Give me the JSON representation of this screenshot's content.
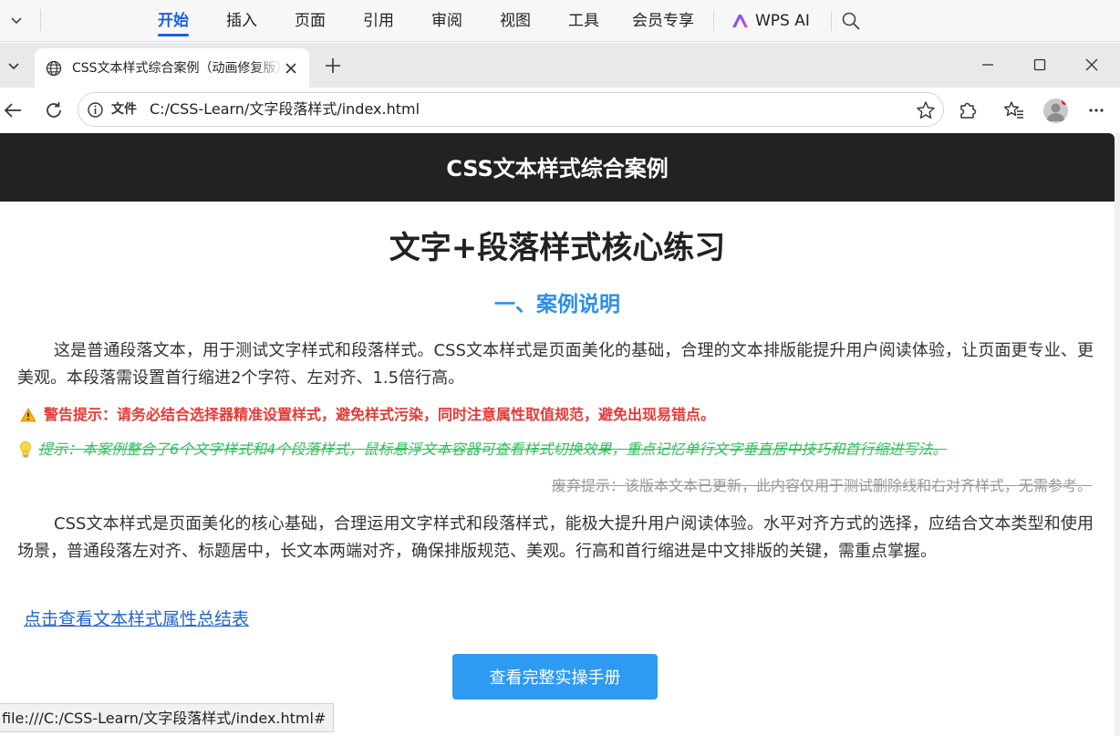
{
  "wps_ribbon": {
    "menu": [
      "开始",
      "插入",
      "页面",
      "引用",
      "审阅",
      "视图",
      "工具",
      "会员专享"
    ],
    "active_item": "开始",
    "ai_label": "WPS AI"
  },
  "browser": {
    "tab_title": "CSS文本样式综合案例（动画修复版）",
    "omnibox": {
      "scheme_label": "文件",
      "url": "C:/CSS-Learn/文字段落样式/index.html"
    },
    "status_url": "file:///C:/CSS-Learn/文字段落样式/index.html#"
  },
  "page": {
    "header_title": "CSS文本样式综合案例",
    "h1": "文字+段落样式核心练习",
    "h2": "一、案例说明",
    "paragraph1": "这是普通段落文本，用于测试文字样式和段落样式。CSS文本样式是页面美化的基础，合理的文本排版能提升用户阅读体验，让页面更专业、更美观。本段落需设置首行缩进2个字符、左对齐、1.5倍行高。",
    "warning": "警告提示：请务必结合选择器精准设置样式，避免样式污染，同时注意属性取值规范，避免出现易错点。",
    "tip": "提示：本案例整合了6个文字样式和4个段落样式，鼠标悬浮文本容器可查看样式切换效果，重点记忆单行文字垂直居中技巧和首行缩进写法。",
    "deprecated": "废弃提示：该版本文本已更新，此内容仅用于测试删除线和右对齐样式，无需参考。",
    "paragraph2": "CSS文本样式是页面美化的核心基础，合理运用文字样式和段落样式，能极大提升用户阅读体验。水平对齐方式的选择，应结合文本类型和使用场景，普通段落左对齐、标题居中，长文本两端对齐，确保排版规范、美观。行高和首行缩进是中文排版的关键，需重点掌握。",
    "summary_link": "点击查看文本样式属性总结表",
    "manual_button": "查看完整实操手册"
  },
  "colors": {
    "header_bg": "#222222",
    "h2": "#2e8fe6",
    "warning": "#e53935",
    "tip": "#2fbe5a",
    "deprecated": "#9a9a9a",
    "link": "#1f66c9",
    "button": "#2e9af2",
    "ribbon_active": "#1b62d6"
  },
  "icons": [
    "chevron-down-icon",
    "wps-ai-logo-icon",
    "search-icon",
    "tab-list-icon",
    "globe-icon",
    "close-icon",
    "plus-icon",
    "minimize-icon",
    "maximize-icon",
    "window-close-icon",
    "back-arrow-icon",
    "refresh-icon",
    "info-icon",
    "star-icon",
    "extensions-icon",
    "favorites-icon",
    "profile-avatar",
    "more-icon",
    "warning-icon",
    "lightbulb-icon"
  ]
}
